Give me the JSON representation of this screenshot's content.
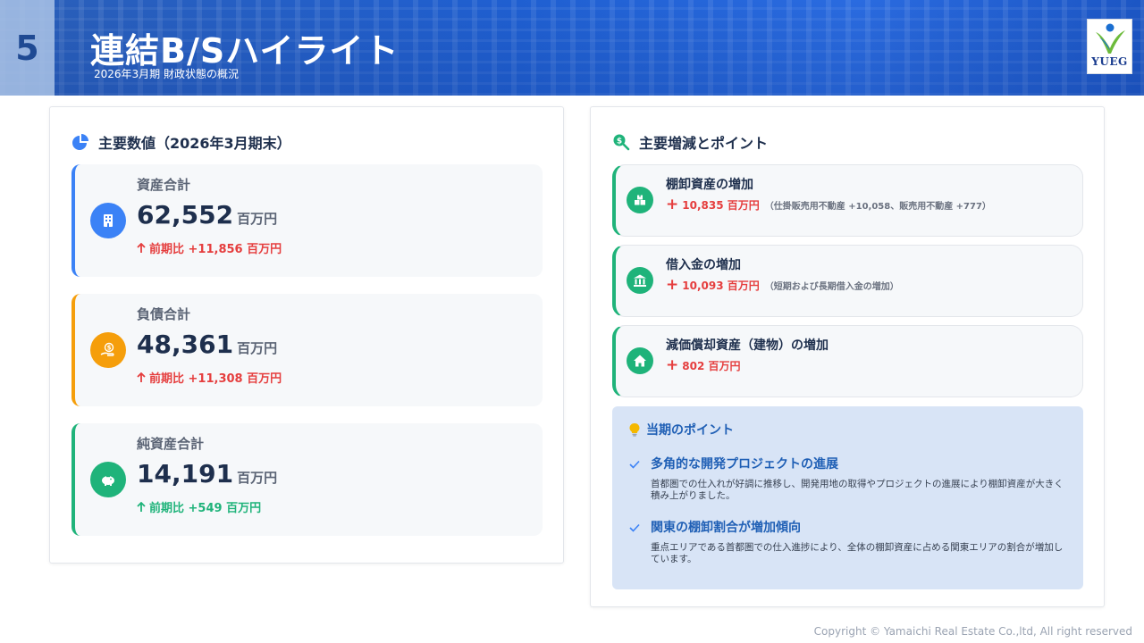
{
  "header": {
    "slide_number": "5",
    "title": "連結B/Sハイライト",
    "subtitle": "2026年3月期 財政状態の概況",
    "logo_text": "YUEG"
  },
  "left_panel": {
    "title": "主要数値（2026年3月期末）",
    "title_icon": "pie-chart-icon",
    "metrics": [
      {
        "label": "資産合計",
        "value": "62,552",
        "unit": "百万円",
        "change": "前期比 +11,856 百万円",
        "direction": "up",
        "accent": "#3b82f6",
        "change_color": "#e53e3e",
        "icon": "building-icon"
      },
      {
        "label": "負債合計",
        "value": "48,361",
        "unit": "百万円",
        "change": "前期比 +11,308 百万円",
        "direction": "up",
        "accent": "#f59e0b",
        "change_color": "#e53e3e",
        "icon": "hand-coin-icon"
      },
      {
        "label": "純資産合計",
        "value": "14,191",
        "unit": "百万円",
        "change": "前期比 +549 百万円",
        "direction": "up",
        "accent": "#1fb37a",
        "change_color": "#1fb37a",
        "icon": "piggy-bank-icon"
      }
    ]
  },
  "right_panel": {
    "title": "主要増減とポイント",
    "title_icon": "search-dollar-icon",
    "changes": [
      {
        "title": "棚卸資産の増加",
        "sign": "+",
        "amount": "10,835 百万円",
        "note": "（仕掛販売用不動産 +10,058、販売用不動産 +777）",
        "icon": "boxes-icon"
      },
      {
        "title": "借入金の増加",
        "sign": "+",
        "amount": "10,093 百万円",
        "note": "（短期および長期借入金の増加）",
        "icon": "bank-icon"
      },
      {
        "title": "減価償却資産（建物）の増加",
        "sign": "+",
        "amount": "802 百万円",
        "note": "",
        "icon": "house-icon"
      }
    ],
    "points": {
      "heading": "当期のポイント",
      "heading_icon": "lightbulb-icon",
      "items": [
        {
          "title": "多角的な開発プロジェクトの進展",
          "desc": "首都圏での仕入れが好調に推移し、開発用地の取得やプロジェクトの進展により棚卸資産が大きく積み上がりました。"
        },
        {
          "title": "関東の棚卸割合が増加傾向",
          "desc": "重点エリアである首都圏での仕入進捗により、全体の棚卸資産に占める関東エリアの割合が増加しています。"
        }
      ]
    }
  },
  "footer": {
    "copyright": "Copyright © Yamaichi Real Estate Co.,ltd, All right reserved"
  }
}
